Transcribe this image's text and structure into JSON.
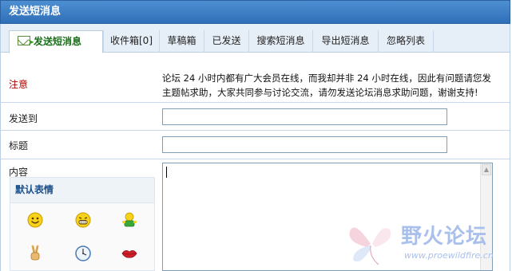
{
  "window": {
    "title": "发送短消息"
  },
  "tabs": [
    {
      "label": "发送短消息",
      "active": true
    },
    {
      "label": "收件箱[0]"
    },
    {
      "label": "草稿箱"
    },
    {
      "label": "已发送"
    },
    {
      "label": "搜索短消息"
    },
    {
      "label": "导出短消息"
    },
    {
      "label": "忽略列表"
    }
  ],
  "form": {
    "notice_label": "注意",
    "notice_line1": "论坛 24 小时内都有广大会员在线，而我却并非 24 小时在线，因此有问题请您发",
    "notice_line2": "主题帖求助，大家共同参与讨论交流，请勿发送论坛消息求助问题，谢谢支持!",
    "send_to_label": "发送到",
    "send_to_value": "",
    "subject_label": "标题",
    "subject_value": "",
    "content_label": "内容"
  },
  "emoticons": {
    "title": "默认表情",
    "items": [
      "smile-icon",
      "grin-icon",
      "green-figure-icon",
      "victory-hand-icon",
      "clock-icon",
      "lips-icon"
    ]
  },
  "watermark": {
    "text": "野火论坛",
    "url": "www.proewildfire.cn"
  }
}
